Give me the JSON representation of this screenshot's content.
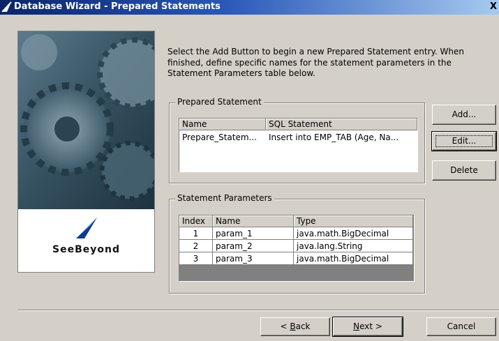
{
  "window": {
    "title": "Database Wizard - Prepared Statements",
    "close_glyph": "X"
  },
  "brand": {
    "name": "SeeBeyond"
  },
  "instructions": "Select the Add Button to begin a new Prepared Statement entry. When finished, define specific names for the statement parameters in the Statement Parameters table below.",
  "prepared_statement": {
    "legend": "Prepared Statement",
    "columns": [
      "Name",
      "SQL Statement"
    ],
    "rows": [
      {
        "name": "Prepare_Statem...",
        "sql": "Insert into EMP_TAB (Age, Na..."
      }
    ]
  },
  "side_buttons": {
    "add": "Add...",
    "edit": "Edit...",
    "delete": "Delete"
  },
  "statement_parameters": {
    "legend": "Statement Parameters",
    "columns": [
      "Index",
      "Name",
      "Type"
    ],
    "rows": [
      {
        "index": "1",
        "name": "param_1",
        "type": "java.math.BigDecimal"
      },
      {
        "index": "2",
        "name": "param_2",
        "type": "java.lang.String"
      },
      {
        "index": "3",
        "name": "param_3",
        "type": "java.math.BigDecimal"
      }
    ]
  },
  "footer": {
    "back": {
      "mnemonic": "B",
      "rest": "ack",
      "prefix": "< "
    },
    "next": {
      "mnemonic": "N",
      "rest": "ext",
      "suffix": " >"
    },
    "cancel": "Cancel"
  },
  "colors": {
    "title_start": "#0a246a",
    "title_end": "#a6caf0",
    "face": "#d4d0c8",
    "selection_row": "#ffffff"
  },
  "icons": [
    "app-icon",
    "close-icon",
    "seebeyond-logo"
  ]
}
